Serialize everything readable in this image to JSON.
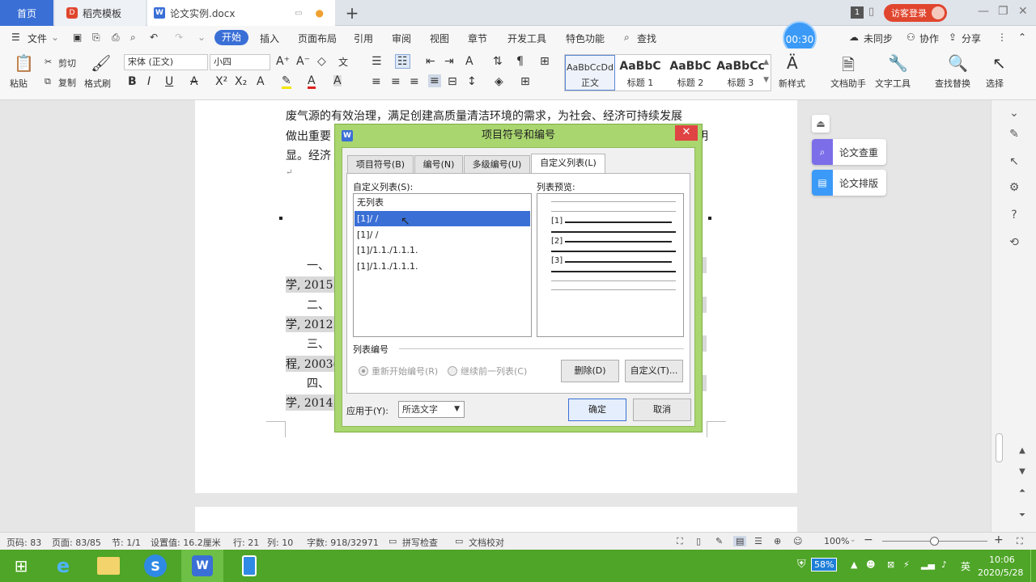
{
  "tabs": {
    "home": "首页",
    "templates": "稻壳模板",
    "document": "论文实例.docx",
    "add": "+"
  },
  "window": {
    "count": "1",
    "visitor_login": "访客登录"
  },
  "menu": {
    "file": "文件",
    "items": [
      "开始",
      "插入",
      "页面布局",
      "引用",
      "审阅",
      "视图",
      "章节",
      "开发工具",
      "特色功能"
    ],
    "search": "查找",
    "timer": "00:30",
    "sync": "未同步",
    "collab": "协作",
    "share": "分享"
  },
  "ribbon": {
    "paste": "粘贴",
    "cut": "剪切",
    "copy": "复制",
    "format_painter": "格式刷",
    "font_name": "宋体 (正文)",
    "font_size": "小四",
    "styles": [
      {
        "preview": "AaBbCcDd",
        "name": "正文"
      },
      {
        "preview": "AaBbC",
        "name": "标题 1"
      },
      {
        "preview": "AaBbC",
        "name": "标题 2"
      },
      {
        "preview": "AaBbCc",
        "name": "标题 3"
      }
    ],
    "new_style": "新样式",
    "doc_assistant": "文档助手",
    "text_tools": "文字工具",
    "find_replace": "查找替换",
    "select": "选择"
  },
  "document": {
    "line1": "废气源的有效治理，满足创建高质量清洁环境的需求，为社会、经济可持续发展",
    "line2a": "做出重要",
    "line2b": "明",
    "line3": "显。经济",
    "refs": [
      {
        "a": "一、",
        "b": "学, 2015."
      },
      {
        "a": "二、",
        "b": "学, 2012."
      },
      {
        "a": "三、",
        "b": "程, 2003("
      },
      {
        "a": "四、",
        "b": "学, 2014."
      }
    ]
  },
  "side_buttons": {
    "check": "论文查重",
    "layout": "论文排版"
  },
  "dialog": {
    "title": "项目符号和编号",
    "tabs": [
      "项目符号(B)",
      "编号(N)",
      "多级编号(U)",
      "自定义列表(L)"
    ],
    "custom_list_label": "自定义列表(S):",
    "preview_label": "列表预览:",
    "list_items": [
      "无列表",
      "[1]/  /",
      "[1]/  /",
      "[1]/1.1./1.1.1.",
      "[1]/1.1./1.1.1."
    ],
    "preview_nums": [
      "[1]",
      "[2]",
      "[3]"
    ],
    "numbering_label": "列表编号",
    "restart": "重新开始编号(R)",
    "continue": "继续前一列表(C)",
    "delete": "删除(D)",
    "customize": "自定义(T)...",
    "apply_to_label": "应用于(Y):",
    "apply_to_value": "所选文字",
    "ok": "确定",
    "cancel": "取消"
  },
  "status": {
    "page_code": "页码: 83",
    "pages": "页面: 83/85",
    "section": "节: 1/1",
    "setting": "设置值: 16.2厘米",
    "row": "行: 21",
    "col": "列: 10",
    "words": "字数: 918/32971",
    "spell": "拼写检查",
    "proofread": "文档校对",
    "zoom": "100%"
  },
  "tray": {
    "battery": "58%",
    "lang": "英",
    "time": "10:06",
    "date": "2020/5/28"
  }
}
